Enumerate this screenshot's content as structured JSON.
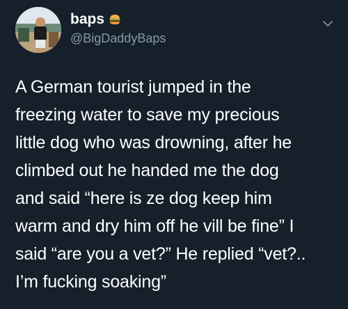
{
  "author": {
    "display_name": "baps",
    "name_emoji": "hamburger-icon",
    "handle": "@BigDaddyBaps"
  },
  "tweet": {
    "lines": [
      "A German tourist jumped in the",
      "freezing water to save my precious",
      "little dog who was drowning, after he",
      "climbed out he handed me the dog",
      "and said “here is ze dog keep him",
      "warm and dry him off he vill be fine” I",
      "said “are you a vet?” He replied “vet?..",
      "I’m fucking soaking”"
    ]
  },
  "menu": {
    "icon": "chevron-down-icon"
  },
  "colors": {
    "background": "#15202b",
    "text": "#ffffff",
    "secondary_text": "#8899a6"
  }
}
